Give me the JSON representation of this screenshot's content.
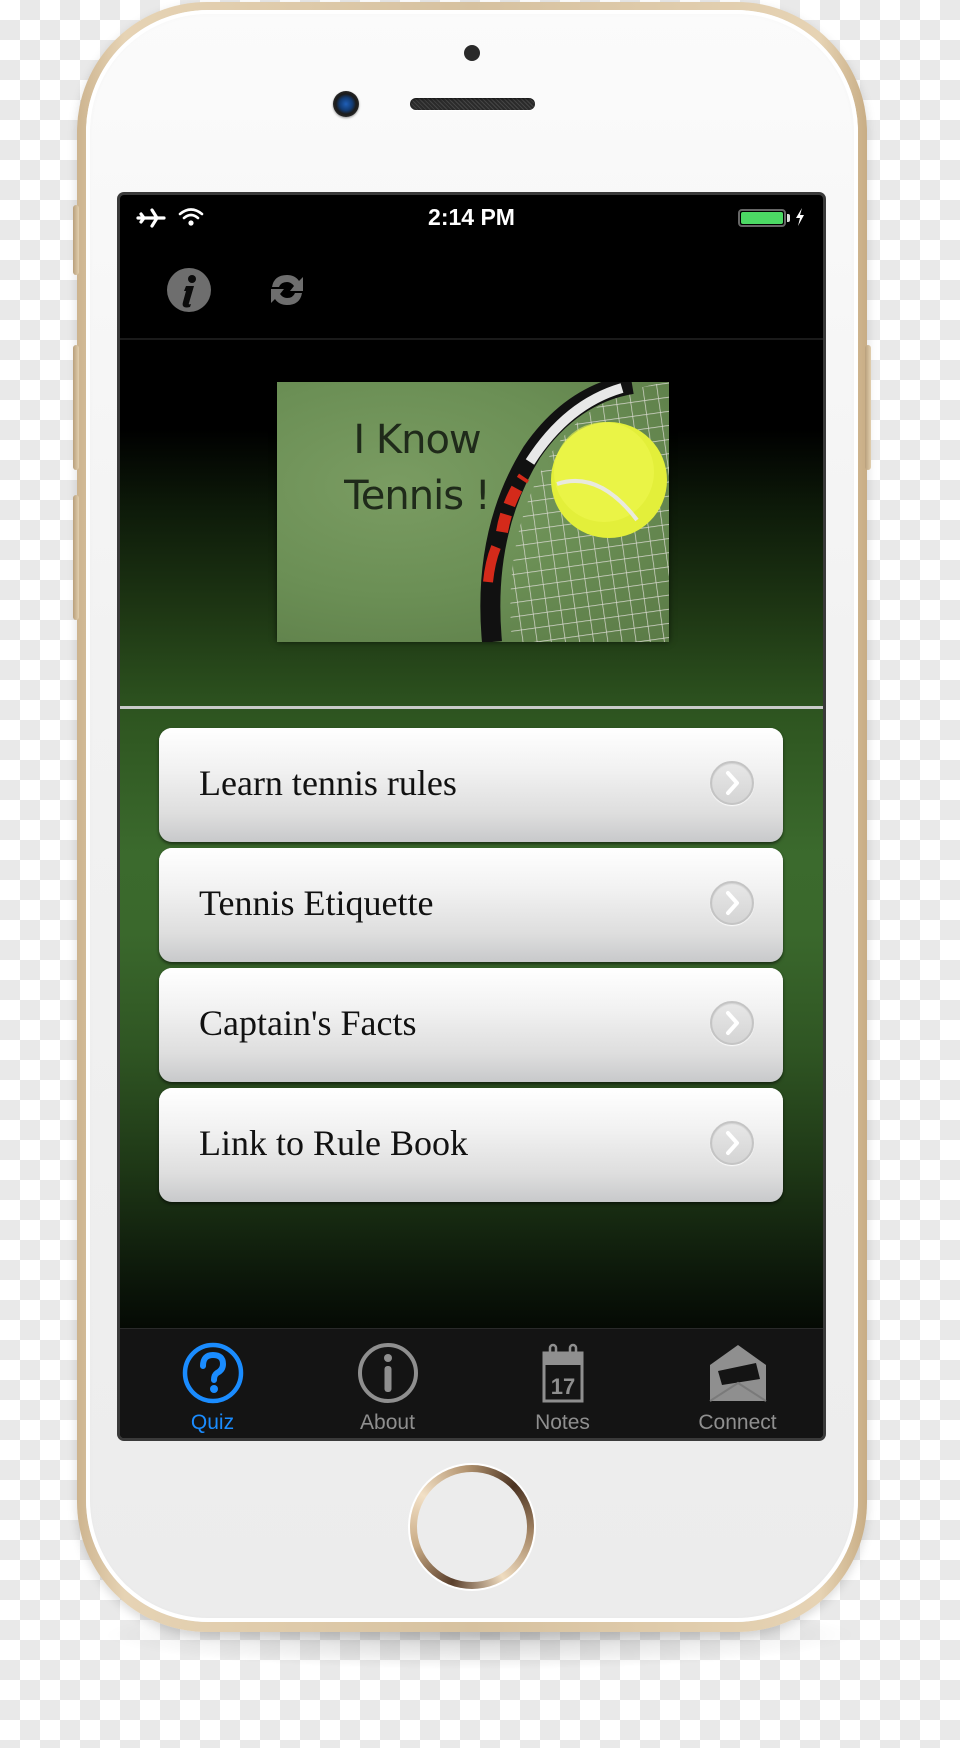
{
  "status_bar": {
    "time": "2:14 PM",
    "airplane_mode": true,
    "wifi": true,
    "battery_level": 1.0,
    "charging": true,
    "battery_color": "#4cd964"
  },
  "nav_bar": {
    "left_buttons": [
      {
        "icon": "info-icon"
      },
      {
        "icon": "refresh-icon"
      }
    ]
  },
  "logo": {
    "line1": "I Know",
    "line2": "Tennis !"
  },
  "menu": {
    "items": [
      {
        "label": "Learn tennis rules"
      },
      {
        "label": "Tennis Etiquette"
      },
      {
        "label": "Captain's Facts"
      },
      {
        "label": "Link to Rule Book"
      }
    ]
  },
  "tab_bar": {
    "active_color": "#1a8cff",
    "inactive_color": "#8f8f8f",
    "tabs": [
      {
        "label": "Quiz",
        "icon": "question-circle-icon",
        "active": true
      },
      {
        "label": "About",
        "icon": "info-circle-icon",
        "active": false
      },
      {
        "label": "Notes",
        "icon": "calendar-icon",
        "calendar_day": "17",
        "active": false
      },
      {
        "label": "Connect",
        "icon": "open-envelope-icon",
        "active": false
      }
    ]
  }
}
